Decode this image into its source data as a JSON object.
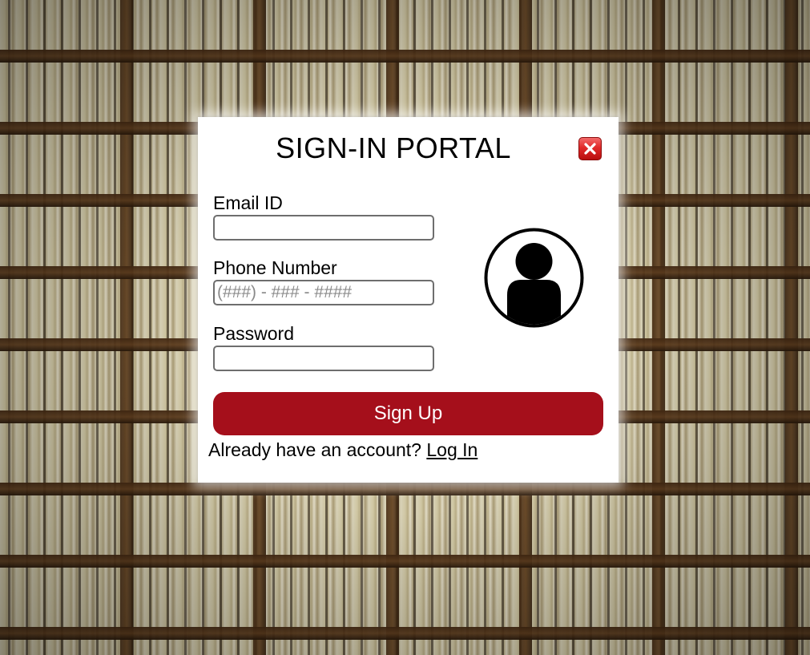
{
  "background": {
    "icon": "library-bookshelves-photo"
  },
  "modal": {
    "title": "SIGN-IN PORTAL",
    "close_icon": "close-icon",
    "colors": {
      "close_button": "#e12a2a",
      "primary_button": "#a50f1b"
    },
    "fields": {
      "email": {
        "label": "Email ID",
        "value": "",
        "placeholder": ""
      },
      "phone": {
        "label": "Phone Number",
        "value": "",
        "placeholder": "(###) - ### - ####"
      },
      "password": {
        "label": "Password",
        "value": "",
        "placeholder": ""
      }
    },
    "avatar_icon": "user-avatar-icon",
    "submit_label": "Sign Up",
    "footer": {
      "prompt": "Already have an account?",
      "link": "Log In"
    }
  }
}
